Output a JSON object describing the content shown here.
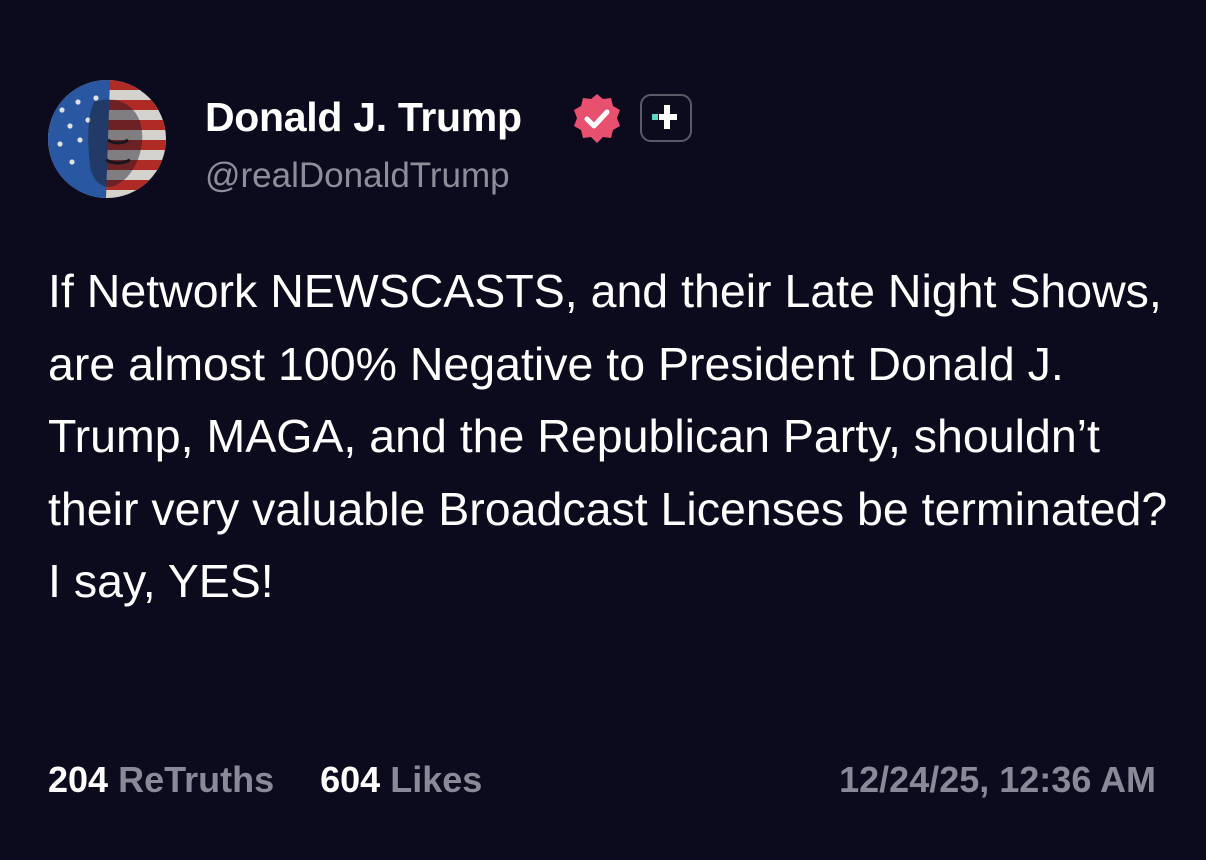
{
  "author": {
    "name": "Donald J. Trump",
    "handle": "@realDonaldTrump",
    "verified": true,
    "avatar_icon": "flag-portrait-avatar",
    "badges": [
      "verified-badge-icon",
      "plus-badge-icon"
    ]
  },
  "post": {
    "text": "If Network NEWSCASTS, and their Late Night Shows, are almost 100% Negative to President Donald J. Trump, MAGA, and the Republican Party, shouldn’t their very valuable Broadcast Licenses be terminated? I say, YES!"
  },
  "stats": {
    "retruths_count": "204",
    "retruths_label": "ReTruths",
    "likes_count": "604",
    "likes_label": "Likes"
  },
  "timestamp": "12/24/25, 12:36 AM",
  "colors": {
    "background": "#0c0b1d",
    "text": "#ffffff",
    "muted": "#8a8997",
    "verified_badge": "#e8506f",
    "plus_accent": "#5fd3c4"
  }
}
